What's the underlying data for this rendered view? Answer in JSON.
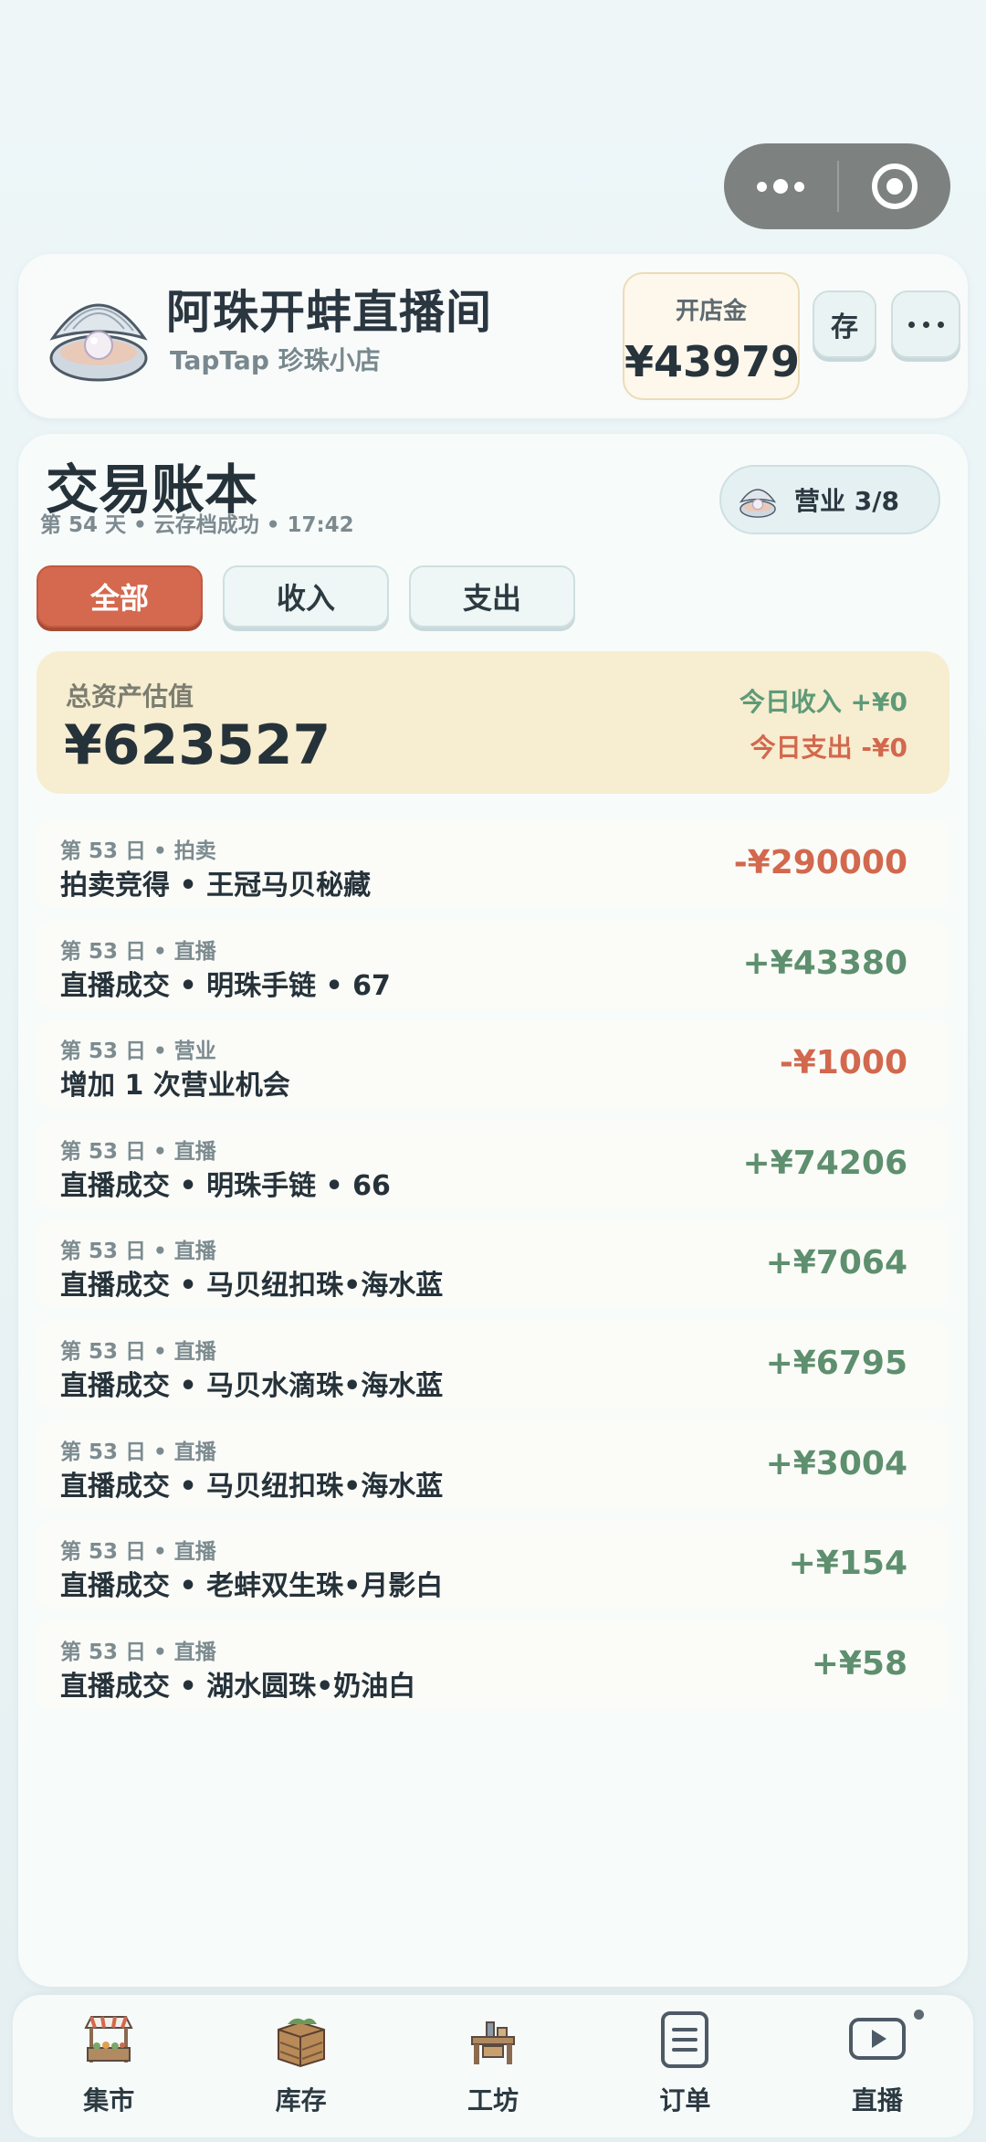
{
  "header": {
    "shop_title": "阿珠开蚌直播间",
    "shop_subtitle": "TapTap 珍珠小店",
    "fund_label": "开店金",
    "fund_value": "¥43979",
    "save_label": "存"
  },
  "ledger": {
    "title": "交易账本",
    "meta": "第 54 天 • 云存档成功 • 17:42",
    "business_label": "营业 3/8",
    "tabs": [
      {
        "label": "全部",
        "active": true
      },
      {
        "label": "收入",
        "active": false
      },
      {
        "label": "支出",
        "active": false
      }
    ],
    "asset_label": "总资产估值",
    "asset_value": "¥623527",
    "today_income": "今日收入 +¥0",
    "today_expense": "今日支出 -¥0",
    "entries": [
      {
        "meta": "第 53 日 • 拍卖",
        "desc": "拍卖竞得 • 王冠马贝秘藏",
        "amount": "-¥290000",
        "sign": "neg"
      },
      {
        "meta": "第 53 日 • 直播",
        "desc": "直播成交 • 明珠手链 • 67",
        "amount": "+¥43380",
        "sign": "pos"
      },
      {
        "meta": "第 53 日 • 营业",
        "desc": "增加 1 次营业机会",
        "amount": "-¥1000",
        "sign": "neg"
      },
      {
        "meta": "第 53 日 • 直播",
        "desc": "直播成交 • 明珠手链 • 66",
        "amount": "+¥74206",
        "sign": "pos"
      },
      {
        "meta": "第 53 日 • 直播",
        "desc": "直播成交 • 马贝纽扣珠•海水蓝",
        "amount": "+¥7064",
        "sign": "pos"
      },
      {
        "meta": "第 53 日 • 直播",
        "desc": "直播成交 • 马贝水滴珠•海水蓝",
        "amount": "+¥6795",
        "sign": "pos"
      },
      {
        "meta": "第 53 日 • 直播",
        "desc": "直播成交 • 马贝纽扣珠•海水蓝",
        "amount": "+¥3004",
        "sign": "pos"
      },
      {
        "meta": "第 53 日 • 直播",
        "desc": "直播成交 • 老蚌双生珠•月影白",
        "amount": "+¥154",
        "sign": "pos"
      },
      {
        "meta": "第 53 日 • 直播",
        "desc": "直播成交 • 湖水圆珠•奶油白",
        "amount": "+¥58",
        "sign": "pos"
      }
    ]
  },
  "nav": {
    "items": [
      {
        "label": "集市",
        "icon": "market-stall-icon"
      },
      {
        "label": "库存",
        "icon": "crate-icon"
      },
      {
        "label": "工坊",
        "icon": "workbench-icon"
      },
      {
        "label": "订单",
        "icon": "document-icon"
      },
      {
        "label": "直播",
        "icon": "play-screen-icon"
      }
    ]
  },
  "colors": {
    "accent": "#d4694f",
    "income": "#5e8f6e",
    "expense": "#d2684e",
    "asset_bg": "#f7edd0"
  }
}
